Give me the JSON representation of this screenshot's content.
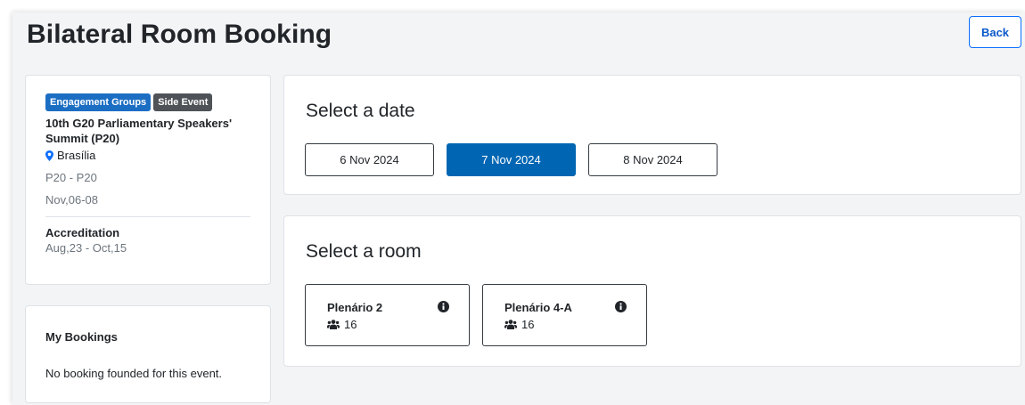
{
  "header": {
    "title": "Bilateral Room Booking",
    "back_label": "Back"
  },
  "event": {
    "badges": [
      "Engagement Groups",
      "Side Event"
    ],
    "name": "10th G20 Parliamentary Speakers' Summit (P20)",
    "location": "Brasília",
    "code": "P20 - P20",
    "dates": "Nov,06-08",
    "accreditation_label": "Accreditation",
    "accreditation_dates": "Aug,23 - Oct,15"
  },
  "bookings": {
    "title": "My Bookings",
    "empty_text": "No booking founded for this event."
  },
  "date_section": {
    "title": "Select a date",
    "dates": [
      {
        "label": "6 Nov 2024",
        "selected": false
      },
      {
        "label": "7 Nov 2024",
        "selected": true
      },
      {
        "label": "8 Nov 2024",
        "selected": false
      }
    ]
  },
  "room_section": {
    "title": "Select a room",
    "rooms": [
      {
        "name": "Plenário 2",
        "capacity": "16"
      },
      {
        "name": "Plenário 4-A",
        "capacity": "16"
      }
    ]
  },
  "icons": {
    "location": "map-pin-icon",
    "info": "info-circle-icon",
    "capacity": "users-icon"
  },
  "colors": {
    "primary": "#0066b3",
    "badge_blue": "#1c6ec3",
    "badge_dark": "#4f5358"
  }
}
